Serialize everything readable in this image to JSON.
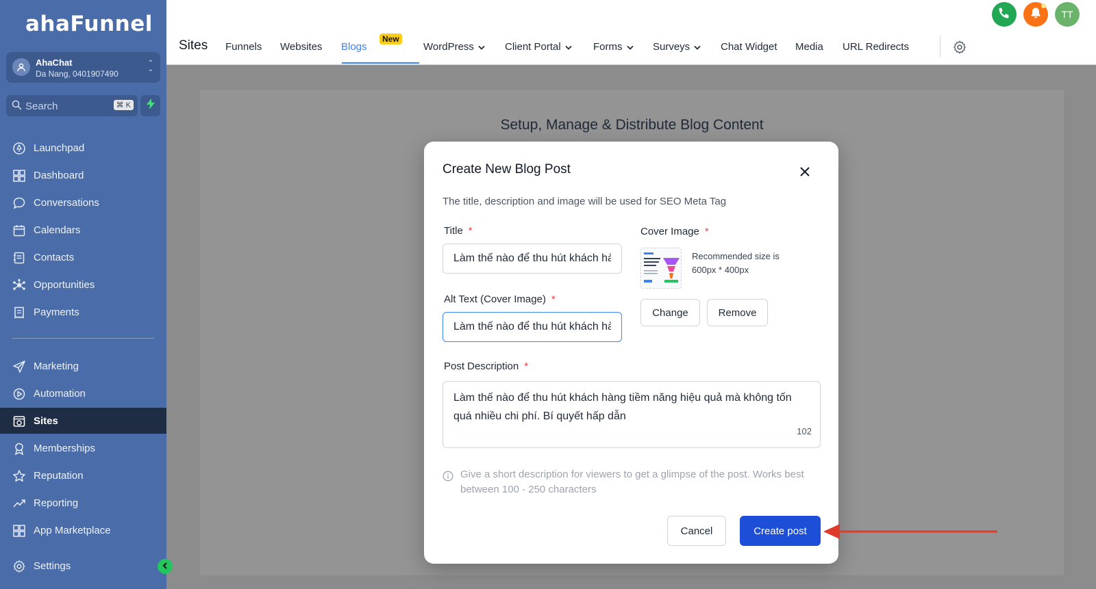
{
  "sidebar": {
    "logo": "ahaFunnel",
    "account": {
      "name": "AhaChat",
      "location": "Da Nang, 0401907490"
    },
    "search": {
      "placeholder": "Search",
      "shortcut": "⌘ K"
    },
    "items": [
      {
        "label": "Launchpad",
        "icon": "rocket-icon"
      },
      {
        "label": "Dashboard",
        "icon": "grid-icon"
      },
      {
        "label": "Conversations",
        "icon": "chat-icon"
      },
      {
        "label": "Calendars",
        "icon": "calendar-icon"
      },
      {
        "label": "Contacts",
        "icon": "contacts-icon"
      },
      {
        "label": "Opportunities",
        "icon": "network-icon"
      },
      {
        "label": "Payments",
        "icon": "receipt-icon"
      },
      {
        "label": "Marketing",
        "icon": "send-icon"
      },
      {
        "label": "Automation",
        "icon": "automation-icon"
      },
      {
        "label": "Sites",
        "icon": "globe-icon",
        "active": true
      },
      {
        "label": "Memberships",
        "icon": "award-icon"
      },
      {
        "label": "Reputation",
        "icon": "star-icon"
      },
      {
        "label": "Reporting",
        "icon": "trend-icon"
      },
      {
        "label": "App Marketplace",
        "icon": "apps-icon"
      },
      {
        "label": "Settings",
        "icon": "gear-icon"
      }
    ]
  },
  "header": {
    "title": "Sites",
    "tabs": [
      {
        "label": "Funnels"
      },
      {
        "label": "Websites"
      },
      {
        "label": "Blogs",
        "active": true,
        "badge": "New"
      },
      {
        "label": "WordPress",
        "dropdown": true
      },
      {
        "label": "Client Portal",
        "dropdown": true
      },
      {
        "label": "Forms",
        "dropdown": true
      },
      {
        "label": "Surveys",
        "dropdown": true
      },
      {
        "label": "Chat Widget"
      },
      {
        "label": "Media"
      },
      {
        "label": "URL Redirects"
      }
    ],
    "user_initials": "TT"
  },
  "main": {
    "heading": "Setup, Manage & Distribute Blog Content"
  },
  "modal": {
    "title": "Create New Blog Post",
    "subtitle": "The title, description and image will be used for SEO Meta Tag",
    "title_label": "Title",
    "title_value": "Làm thế nào để thu hút khách hàng tiềm năng hiệu quả",
    "alt_label": "Alt Text (Cover Image)",
    "alt_value": "Làm thế nào để thu hút khách hàng tiềm năng hiệu quả",
    "cover_label": "Cover Image",
    "recommended": "Recommended size is 600px * 400px",
    "change_label": "Change",
    "remove_label": "Remove",
    "desc_label": "Post Description",
    "desc_value": "Làm thế nào để thu hút khách hàng tiềm năng hiệu quả mà không tốn quá nhiều chi phí. Bí quyết hấp dẫn",
    "char_count": "102",
    "hint": "Give a short description for viewers to get a glimpse of the post. Works best between 100 - 250 characters",
    "cancel_label": "Cancel",
    "create_label": "Create post",
    "required_mark": "*"
  },
  "colors": {
    "sidebar": "#4a6ca8",
    "accent": "#3b82f6",
    "primary_button": "#1d4ed8",
    "annotation_arrow": "#e03a2b"
  }
}
